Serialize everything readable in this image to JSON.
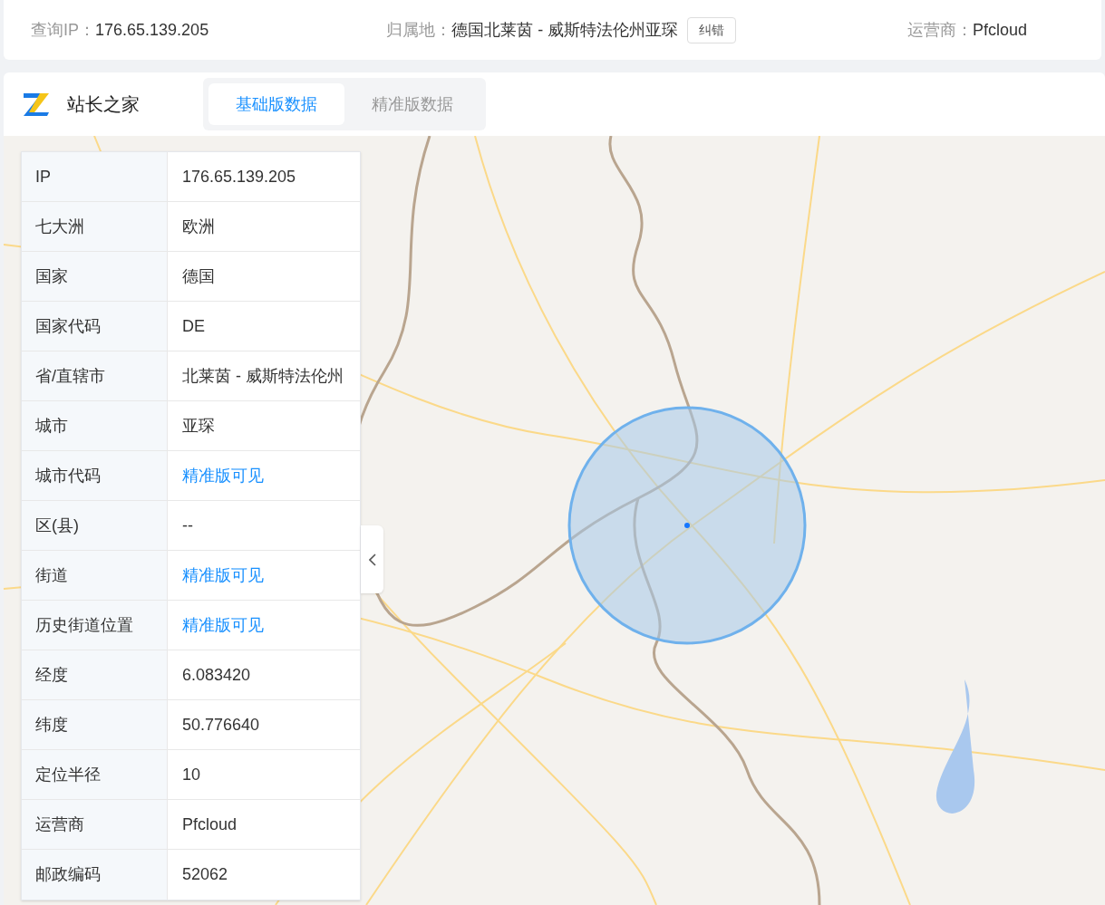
{
  "query_bar": {
    "ip_label": "查询IP：",
    "ip": "176.65.139.205",
    "location_label": "归属地：",
    "location": "德国北莱茵 - 威斯特法伦州亚琛",
    "correct_button": "纠错",
    "isp_label": "运营商：",
    "isp": "Pfcloud"
  },
  "brand": {
    "name": "站长之家"
  },
  "tabs": [
    {
      "label": "基础版数据",
      "selected": true
    },
    {
      "label": "精准版数据",
      "selected": false
    }
  ],
  "info_table": {
    "rows": [
      {
        "label": "IP",
        "value": "176.65.139.205",
        "kind": "text"
      },
      {
        "label": "七大洲",
        "value": "欧洲",
        "kind": "text"
      },
      {
        "label": "国家",
        "value": "德国",
        "kind": "text"
      },
      {
        "label": "国家代码",
        "value": "DE",
        "kind": "text"
      },
      {
        "label": "省/直辖市",
        "value": "北莱茵 - 威斯特法伦州",
        "kind": "text"
      },
      {
        "label": "城市",
        "value": "亚琛",
        "kind": "text"
      },
      {
        "label": "城市代码",
        "value": "精准版可见",
        "kind": "link"
      },
      {
        "label": "区(县)",
        "value": "--",
        "kind": "text"
      },
      {
        "label": "街道",
        "value": "精准版可见",
        "kind": "link"
      },
      {
        "label": "历史街道位置",
        "value": "精准版可见",
        "kind": "link"
      },
      {
        "label": "经度",
        "value": "6.083420",
        "kind": "text"
      },
      {
        "label": "纬度",
        "value": "50.776640",
        "kind": "text"
      },
      {
        "label": "定位半径",
        "value": "10",
        "kind": "text"
      },
      {
        "label": "运营商",
        "value": "Pfcloud",
        "kind": "text"
      },
      {
        "label": "邮政编码",
        "value": "52062",
        "kind": "text"
      }
    ]
  }
}
